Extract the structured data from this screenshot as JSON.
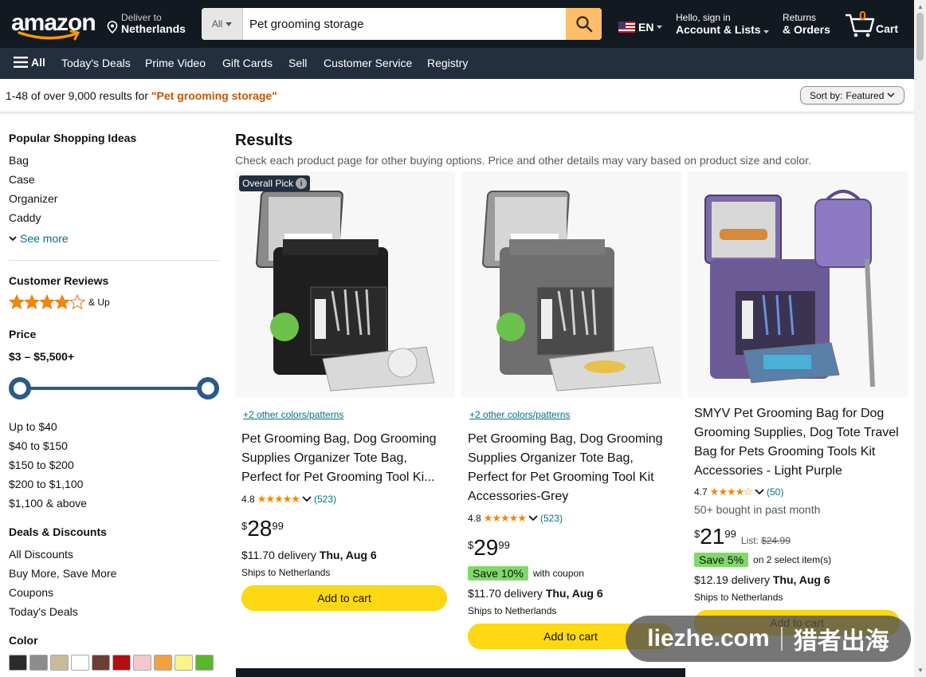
{
  "header": {
    "logo": "amazon",
    "deliver_line1": "Deliver to",
    "deliver_line2": "Netherlands",
    "search_category": "All",
    "search_value": "Pet grooming storage",
    "language": "EN",
    "account_line1": "Hello, sign in",
    "account_line2": "Account & Lists",
    "returns_line1": "Returns",
    "returns_line2": "& Orders",
    "cart_count": "0",
    "cart_label": "Cart"
  },
  "nav": {
    "all": "All",
    "items": [
      "Today's Deals",
      "Prime Video",
      "Gift Cards",
      "Sell",
      "Customer Service",
      "Registry"
    ]
  },
  "results_bar": {
    "prefix": "1-48 of over 9,000 results for ",
    "query": "\"Pet grooming storage\"",
    "sort_label": "Sort by:",
    "sort_value": "Featured"
  },
  "sidebar": {
    "popular_title": "Popular Shopping Ideas",
    "popular": [
      "Bag",
      "Case",
      "Organizer",
      "Caddy"
    ],
    "see_more": "See more",
    "reviews_title": "Customer Reviews",
    "reviews_stars": 4,
    "reviews_suffix": "& Up",
    "price_title": "Price",
    "price_range": "$3 – $5,500+",
    "price_ranges": [
      "Up to $40",
      "$40 to $150",
      "$150 to $200",
      "$200 to $1,100",
      "$1,100 & above"
    ],
    "deals_title": "Deals & Discounts",
    "deals": [
      "All Discounts",
      "Buy More, Save More",
      "Coupons",
      "Today's Deals"
    ],
    "color_title": "Color",
    "colors": [
      "#2b2b2b",
      "#8c8c8c",
      "#c9bb99",
      "#ffffff",
      "#6b3e2e",
      "#b30f0f",
      "#f7c7cf",
      "#f3a03e",
      "#f7f58a",
      "#5ab72b"
    ]
  },
  "results": {
    "heading": "Results",
    "subheading": "Check each product page for other buying options. Price and other details may vary based on product size and color."
  },
  "products": [
    {
      "badge": "Overall Pick",
      "colors_link": "+2 other colors/patterns",
      "title": "Pet Grooming Bag, Dog Grooming Supplies Organizer Tote Bag, Perfect for Pet Grooming Tool Ki...",
      "rating": "4.8",
      "reviews": "(523)",
      "price_symbol": "$",
      "price_whole": "28",
      "price_frac": "99",
      "delivery_price": "$11.70 delivery ",
      "delivery_date": "Thu, Aug 6",
      "ships": "Ships to Netherlands",
      "add_to_cart": "Add to cart"
    },
    {
      "colors_link": "+2 other colors/patterns",
      "title": "Pet Grooming Bag, Dog Grooming Supplies Organizer Tote Bag, Perfect for Pet Grooming Tool Kit Accessories-Grey",
      "rating": "4.8",
      "reviews": "(523)",
      "price_symbol": "$",
      "price_whole": "29",
      "price_frac": "99",
      "save_tag": "Save 10%",
      "save_note": "with coupon",
      "delivery_price": "$11.70 delivery ",
      "delivery_date": "Thu, Aug 6",
      "ships": "Ships to Netherlands",
      "add_to_cart": "Add to cart"
    },
    {
      "title": "SMYV Pet Grooming Bag for Dog Grooming Supplies, Dog Tote Travel Bag for Pets Grooming Tools Kit Accessories - Light Purple",
      "rating": "4.7",
      "reviews": "(50)",
      "bought": "50+ bought in past month",
      "price_symbol": "$",
      "price_whole": "21",
      "price_frac": "99",
      "list_label": "List: ",
      "list_price": "$24.99",
      "save_tag": "Save 5%",
      "save_note": "on 2 select item(s)",
      "delivery_price": "$12.19 delivery ",
      "delivery_date": "Thu, Aug 6",
      "ships": "Ships to Netherlands",
      "add_to_cart": "Add to cart"
    }
  ],
  "watermark": {
    "latin": "liezhe.com",
    "cjk": "猎者出海"
  }
}
